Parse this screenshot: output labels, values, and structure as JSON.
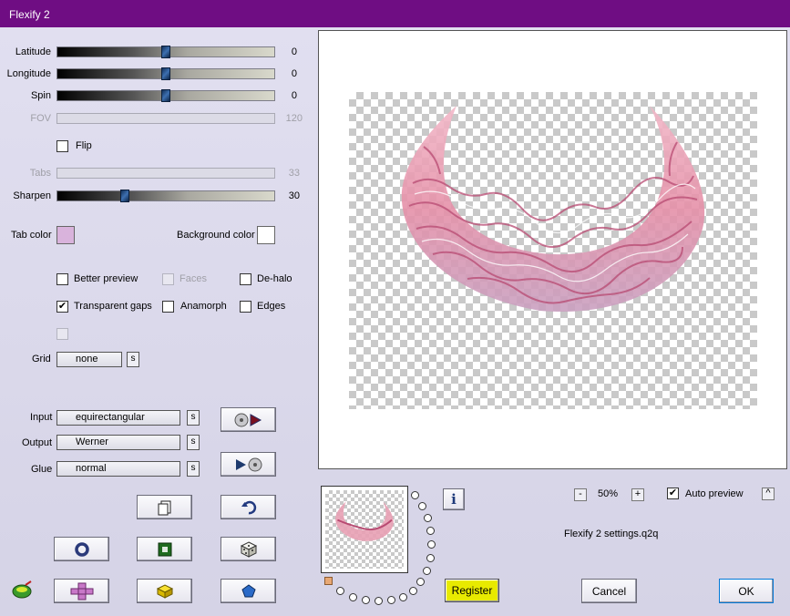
{
  "window": {
    "title": "Flexify 2"
  },
  "sliders": [
    {
      "label": "Latitude",
      "value": "0",
      "level": 0.5,
      "enabled": true
    },
    {
      "label": "Longitude",
      "value": "0",
      "level": 0.5,
      "enabled": true
    },
    {
      "label": "Spin",
      "value": "0",
      "level": 0.5,
      "enabled": true
    },
    {
      "label": "FOV",
      "value": "120",
      "level": 0.0,
      "enabled": false
    },
    {
      "label": "Tabs",
      "value": "33",
      "level": 0.0,
      "enabled": false
    },
    {
      "label": "Sharpen",
      "value": "30",
      "level": 0.3,
      "enabled": true
    }
  ],
  "flip": {
    "label": "Flip",
    "checked": false
  },
  "colors": {
    "tab_label": "Tab color",
    "tab_value": "#d9b3dc",
    "background_label": "Background color",
    "background_value": "#ffffff",
    "accent": "#6f0d83",
    "register_bg": "#e8ea00"
  },
  "options": {
    "better_preview": {
      "label": "Better preview",
      "checked": false
    },
    "faces": {
      "label": "Faces",
      "checked": false,
      "enabled": false
    },
    "de_halo": {
      "label": "De-halo",
      "checked": false
    },
    "transparent_gaps": {
      "label": "Transparent gaps",
      "checked": true
    },
    "anamorph": {
      "label": "Anamorph",
      "checked": false
    },
    "edges": {
      "label": "Edges",
      "checked": false
    }
  },
  "grid": {
    "label": "Grid",
    "value": "none",
    "s": "s"
  },
  "projection": {
    "input_label": "Input",
    "input_value": "equirectangular",
    "output_label": "Output",
    "output_value": "Werner",
    "glue_label": "Glue",
    "glue_value": "normal",
    "s": "s"
  },
  "zoom": {
    "minus": "-",
    "value": "50%",
    "plus": "+"
  },
  "auto_preview": {
    "label": "Auto preview",
    "checked": true,
    "collapse": "^"
  },
  "info_glyph": "i",
  "settings_file": "Flexify 2 settings.q2q",
  "buttons": {
    "register": "Register",
    "cancel": "Cancel",
    "ok": "OK"
  },
  "icons": [
    "play-from-disc-icon",
    "play-to-disc-icon",
    "copy-icon",
    "undo-icon",
    "ring-icon",
    "square-frame-icon",
    "dice-icon",
    "flexify-logo-icon",
    "plus-grid-icon",
    "yellow-block-icon",
    "pentagon-icon"
  ]
}
